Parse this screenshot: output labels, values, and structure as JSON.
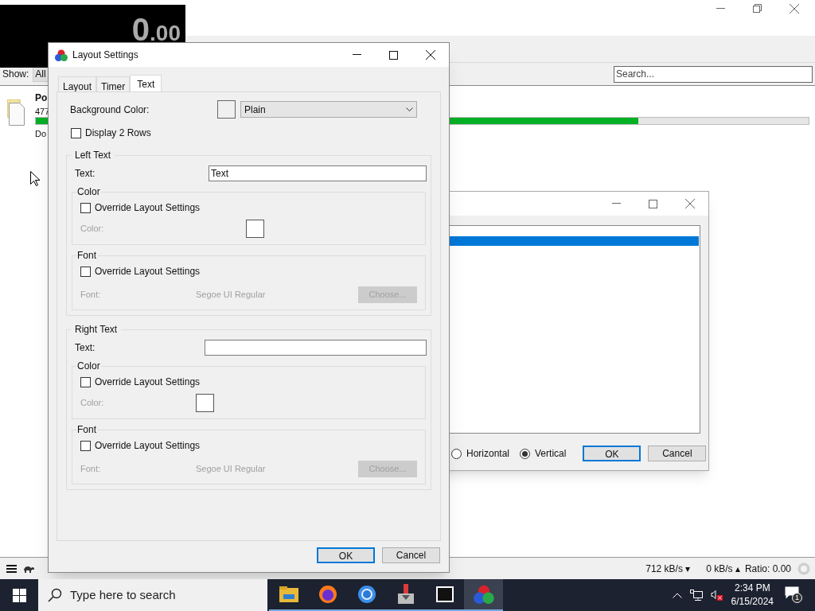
{
  "timer_window": {
    "whole": "0",
    "fraction": ".00"
  },
  "main_window": {
    "show_label": "Show:",
    "filter_tab": "All",
    "search": {
      "placeholder": "Search..."
    },
    "torrent": {
      "name": "Po",
      "size": "477",
      "progress": {
        "level": 0.78
      },
      "status": "Do"
    },
    "status_bar": {
      "download": "712 kB/s ▾",
      "upload": "0 kB/s ▴",
      "ratio": "Ratio: 0.00"
    }
  },
  "list_dialog": {
    "orientation": [
      {
        "label": "Horizontal",
        "selected": false
      },
      {
        "label": "Vertical",
        "selected": true
      }
    ],
    "buttons": [
      {
        "label": "OK",
        "default": true
      },
      {
        "label": "Cancel",
        "default": false
      }
    ]
  },
  "layout_dialog": {
    "title": "Layout Settings",
    "tabs": [
      {
        "label": "Layout",
        "selected": false
      },
      {
        "label": "Timer",
        "selected": false
      },
      {
        "label": "Text",
        "selected": true
      }
    ],
    "background_color": {
      "label": "Background Color:",
      "value": "Plain"
    },
    "display_2_rows": {
      "label": "Display 2 Rows",
      "checked": false
    },
    "groups": [
      {
        "title": "Left Text",
        "text_label": "Text:",
        "text_value": "Text",
        "color": {
          "title": "Color",
          "override": {
            "label": "Override Layout Settings",
            "checked": false
          },
          "color_label": "Color:"
        },
        "font": {
          "title": "Font",
          "override": {
            "label": "Override Layout Settings",
            "checked": false
          },
          "font_label": "Font:",
          "font_value": "Segoe UI Regular",
          "choose": "Choose..."
        }
      },
      {
        "title": "Right Text",
        "text_label": "Text:",
        "color": {
          "title": "Color",
          "override": {
            "label": "Override Layout Settings",
            "checked": false
          },
          "color_label": "Color:"
        },
        "font": {
          "title": "Font",
          "override": {
            "label": "Override Layout Settings",
            "checked": false
          },
          "font_label": "Font:",
          "font_value": "Segoe UI Regular",
          "choose": "Choose..."
        }
      }
    ],
    "buttons": [
      {
        "label": "OK",
        "default": true
      },
      {
        "label": "Cancel",
        "default": false
      }
    ]
  },
  "taskbar": {
    "search": {
      "placeholder": "Type here to search"
    },
    "apps": [
      {
        "kind": "folder",
        "active": false
      },
      {
        "kind": "firefox",
        "active": false
      },
      {
        "kind": "chrome",
        "active": false
      },
      {
        "kind": "installer",
        "active": false
      },
      {
        "kind": "archiver",
        "active": false
      },
      {
        "kind": "splits",
        "active": true
      }
    ],
    "time": "2:34 PM",
    "date": "6/15/2024",
    "notifications": "1"
  }
}
